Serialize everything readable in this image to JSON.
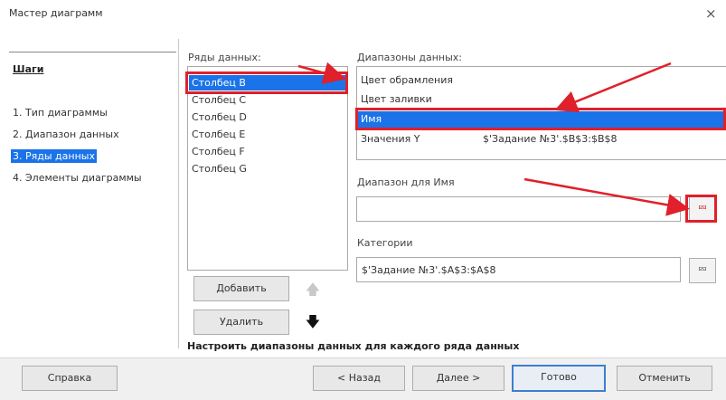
{
  "window": {
    "title": "Мастер диаграмм",
    "close_glyph": "×"
  },
  "steps": {
    "heading": "Шаги",
    "items": [
      {
        "label": "1. Тип диаграммы",
        "active": false
      },
      {
        "label": "2. Диапазон данных",
        "active": false
      },
      {
        "label": "3. Ряды данных",
        "active": true
      },
      {
        "label": "4. Элементы диаграммы",
        "active": false
      }
    ]
  },
  "series": {
    "label": "Ряды данных:",
    "items": [
      "Столбец B",
      "Столбец C",
      "Столбец D",
      "Столбец E",
      "Столбец F",
      "Столбец G"
    ],
    "selected_index": 0,
    "add_label": "Добавить",
    "remove_label": "Удалить",
    "up_glyph": "🡅",
    "down_glyph": "🡇"
  },
  "ranges": {
    "label": "Диапазоны данных:",
    "rows": [
      {
        "name": "Цвет обрамления",
        "value": ""
      },
      {
        "name": "Цвет заливки",
        "value": ""
      },
      {
        "name": "Имя",
        "value": ""
      },
      {
        "name": "Значения Y",
        "value": "$'Задание №3'.$B$3:$B$8"
      }
    ],
    "selected_index": 2
  },
  "range_for": {
    "label": "Диапазон для Имя",
    "value": "",
    "pick_glyph": "⮹"
  },
  "categories": {
    "label": "Категории",
    "value": "$'Задание №3'.$A$3:$A$8",
    "pick_glyph": "⮹"
  },
  "hint": "Настроить диапазоны данных для каждого ряда данных",
  "buttons": {
    "help": "Справка",
    "back": "< Назад",
    "next": "Далее >",
    "finish": "Готово",
    "cancel": "Отменить"
  },
  "colors": {
    "accent": "#1a73e8",
    "annotation_red": "#e0202a"
  }
}
